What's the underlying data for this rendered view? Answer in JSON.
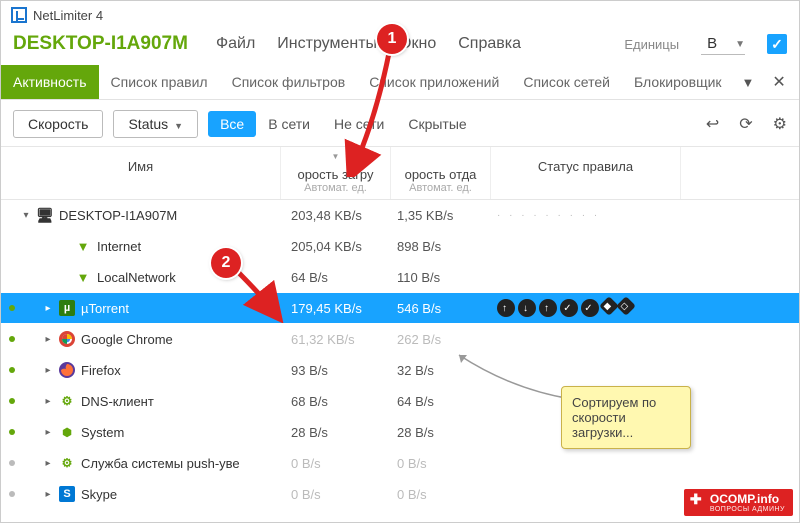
{
  "title": "NetLimiter 4",
  "hostname": "DESKTOP-I1A907M",
  "menu": {
    "file": "Файл",
    "tools": "Инструменты",
    "window": "Окно",
    "help": "Справка"
  },
  "units": {
    "label": "Единицы",
    "value": "B"
  },
  "tabs": {
    "activity": "Активность",
    "rules": "Список правил",
    "filters": "Список фильтров",
    "apps": "Список приложений",
    "nets": "Список сетей",
    "blocker": "Блокировщик"
  },
  "toolbar": {
    "speed": "Скорость",
    "status": "Status",
    "filters": {
      "all": "Все",
      "online": "В сети",
      "offline": "Не  сети",
      "hidden": "Скрытые"
    }
  },
  "columns": {
    "name": "Имя",
    "dl": "орость загру",
    "dl_sub": "Автомат. ед.",
    "ul": "орость отда",
    "ul_sub": "Автомат. ед.",
    "status": "Статус правила"
  },
  "rows": [
    {
      "kind": "root",
      "bullet": false,
      "indent": 0,
      "exp": "▾",
      "icon": "pc",
      "name": "DESKTOP-I1A907M",
      "dl": "203,48 KB/s",
      "ul": "1,35 KB/s",
      "stat": "· · ·   · · ·   · · ·"
    },
    {
      "kind": "net",
      "bullet": false,
      "indent": 2,
      "exp": "",
      "icon": "filter",
      "name": "Internet",
      "dl": "205,04 KB/s",
      "ul": "898 B/s",
      "stat": ""
    },
    {
      "kind": "net",
      "bullet": false,
      "indent": 2,
      "exp": "",
      "icon": "filter",
      "name": "LocalNetwork",
      "dl": "64 B/s",
      "ul": "110 B/s",
      "stat": ""
    },
    {
      "kind": "app",
      "bullet": true,
      "indent": 1,
      "exp": "▸",
      "icon": "ut",
      "name": "µTorrent",
      "dl": "179,45 KB/s",
      "ul": "546 B/s",
      "stat": "badges",
      "sel": true
    },
    {
      "kind": "app",
      "bullet": true,
      "indent": 1,
      "exp": "▸",
      "icon": "chrome",
      "name": "Google Chrome",
      "dl": "61,32 KB/s",
      "ul": "262 B/s",
      "stat": "",
      "dim": true
    },
    {
      "kind": "app",
      "bullet": true,
      "indent": 1,
      "exp": "▸",
      "icon": "ff",
      "name": "Firefox",
      "dl": "93 B/s",
      "ul": "32 B/s",
      "stat": ""
    },
    {
      "kind": "app",
      "bullet": true,
      "indent": 1,
      "exp": "▸",
      "icon": "gear",
      "name": "DNS-клиент",
      "dl": "68 B/s",
      "ul": "64 B/s",
      "stat": ""
    },
    {
      "kind": "app",
      "bullet": true,
      "indent": 1,
      "exp": "▸",
      "icon": "nodes",
      "name": "System",
      "dl": "28 B/s",
      "ul": "28 B/s",
      "stat": ""
    },
    {
      "kind": "app",
      "bullet": "off",
      "indent": 1,
      "exp": "▸",
      "icon": "gear",
      "name": "Служба системы push-уве",
      "dl": "0 B/s",
      "ul": "0 B/s",
      "stat": "",
      "dim": true
    },
    {
      "kind": "app",
      "bullet": "off",
      "indent": 1,
      "exp": "▸",
      "icon": "s",
      "name": "Skype",
      "dl": "0 B/s",
      "ul": "0 B/s",
      "stat": "",
      "dim": true
    }
  ],
  "anno": {
    "b1": "1",
    "b2": "2",
    "callout": "Сортируем по скорости загрузки..."
  },
  "watermark": {
    "main": "OCOMP.info",
    "sub": "ВОПРОСЫ АДМИНУ"
  }
}
